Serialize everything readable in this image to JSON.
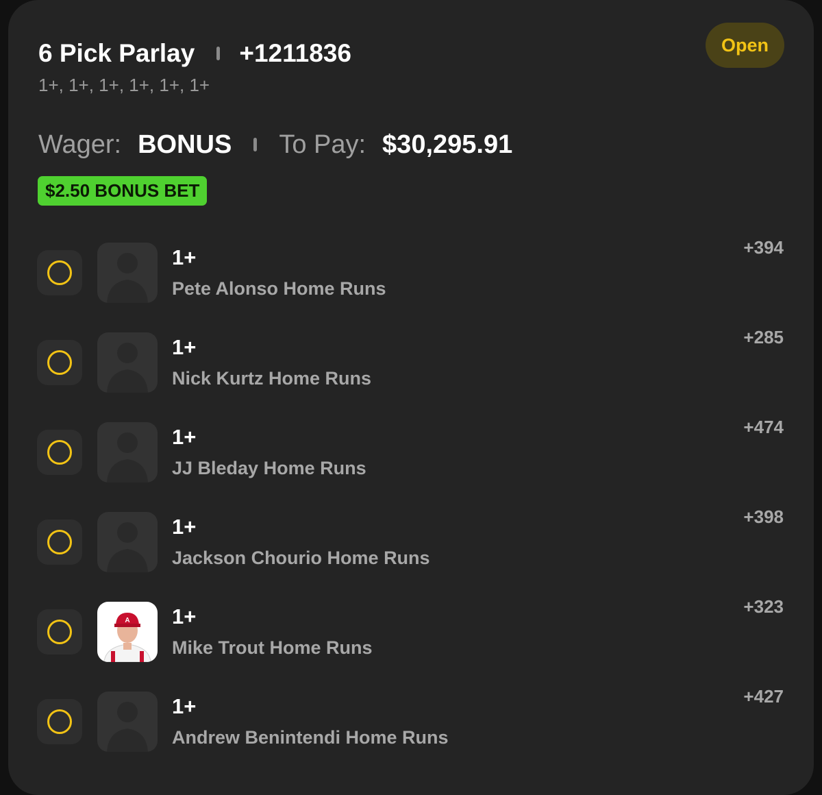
{
  "header": {
    "title": "6 Pick Parlay",
    "total_odds": "+1211836",
    "subtitle": "1+, 1+, 1+, 1+, 1+, 1+",
    "status": "Open"
  },
  "wager": {
    "wager_label": "Wager:",
    "wager_value": "BONUS",
    "to_pay_label": "To Pay:",
    "to_pay_value": "$30,295.91",
    "bonus_tag": "$2.50 BONUS BET"
  },
  "legs": [
    {
      "line": "1+",
      "market": "Pete Alonso Home Runs",
      "odds": "+394",
      "avatar": "person-silhouette-icon"
    },
    {
      "line": "1+",
      "market": "Nick Kurtz Home Runs",
      "odds": "+285",
      "avatar": "person-silhouette-icon"
    },
    {
      "line": "1+",
      "market": "JJ Bleday Home Runs",
      "odds": "+474",
      "avatar": "person-silhouette-icon"
    },
    {
      "line": "1+",
      "market": "Jackson Chourio Home Runs",
      "odds": "+398",
      "avatar": "person-silhouette-icon"
    },
    {
      "line": "1+",
      "market": "Mike Trout Home Runs",
      "odds": "+323",
      "avatar": "player-photo"
    },
    {
      "line": "1+",
      "market": "Andrew Benintendi Home Runs",
      "odds": "+427",
      "avatar": "person-silhouette-icon"
    }
  ],
  "colors": {
    "card_bg": "#242424",
    "accent_yellow": "#f2c315",
    "bonus_green": "#4fd130",
    "muted_text": "#a8a8a8"
  }
}
